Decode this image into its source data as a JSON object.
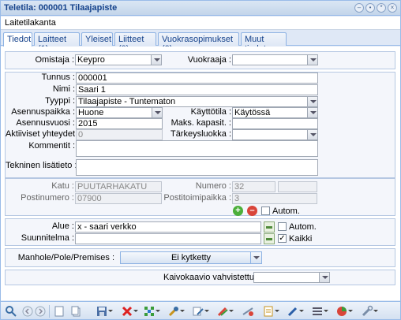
{
  "window": {
    "title": "Teletila: 000001 Tilaajapiste"
  },
  "subtitle": "Laitetilakanta",
  "tabs": [
    "Tiedot",
    "Laitteet (1)",
    "Yleiset",
    "Liitteet (0)",
    "Vuokrasopimukset (0)",
    "Muut tiedot"
  ],
  "owner": {
    "label": "Omistaja :",
    "value": "Keypro",
    "lessor_label": "Vuokraaja :",
    "lessor_value": ""
  },
  "info": {
    "tunnus_label": "Tunnus :",
    "tunnus": "000001",
    "nimi_label": "Nimi :",
    "nimi": "Saari 1",
    "tyyppi_label": "Tyyppi :",
    "tyyppi": "Tilaajapiste - Tuntematon",
    "asennuspaikka_label": "Asennuspaikka :",
    "asennuspaikka": "Huone",
    "kayttotila_label": "Käyttötila :",
    "kayttotila": "Käytössä",
    "asennusvuosi_label": "Asennusvuosi :",
    "asennusvuosi": "2015",
    "maks_label": "Maks. kapasit. :",
    "maks": "",
    "aktiiviset_label": "Aktiiviset yhteydet :",
    "aktiiviset": "0",
    "tarkeys_label": "Tärkeysluokka :",
    "tarkeys": "",
    "kommentit_label": "Kommentit :",
    "tekninen_label": "Tekninen lisätieto :"
  },
  "address": {
    "katu_label": "Katu :",
    "katu": "PUUTARHAKATU",
    "numero_label": "Numero :",
    "numero": "32",
    "numero2": "",
    "postinumero_label": "Postinumero :",
    "postinumero": "07900",
    "postitoimipaikka_label": "Postitoimipaikka :",
    "postitoimipaikka": "3",
    "autom_label": "Autom."
  },
  "area": {
    "alue_label": "Alue :",
    "alue": "x - saari verkko",
    "autom_label": "Autom.",
    "suunnitelma_label": "Suunnitelma :",
    "suunnitelma": "",
    "kaikki_label": "Kaikki"
  },
  "manhole": {
    "label": "Manhole/Pole/Premises :",
    "value": "Ei kytketty"
  },
  "kaivo": {
    "label": "Kaivokaavio vahvistettu :",
    "value": ""
  },
  "toolbar": [
    "search-icon",
    "back-icon",
    "forward-icon",
    "new-icon",
    "copy-icon",
    "save-icon",
    "delete-icon",
    "connect-icon",
    "tools-icon",
    "edit-icon",
    "paint-icon",
    "measure-icon",
    "report-icon",
    "draw-icon",
    "layers-icon",
    "chart-icon",
    "settings-icon"
  ]
}
